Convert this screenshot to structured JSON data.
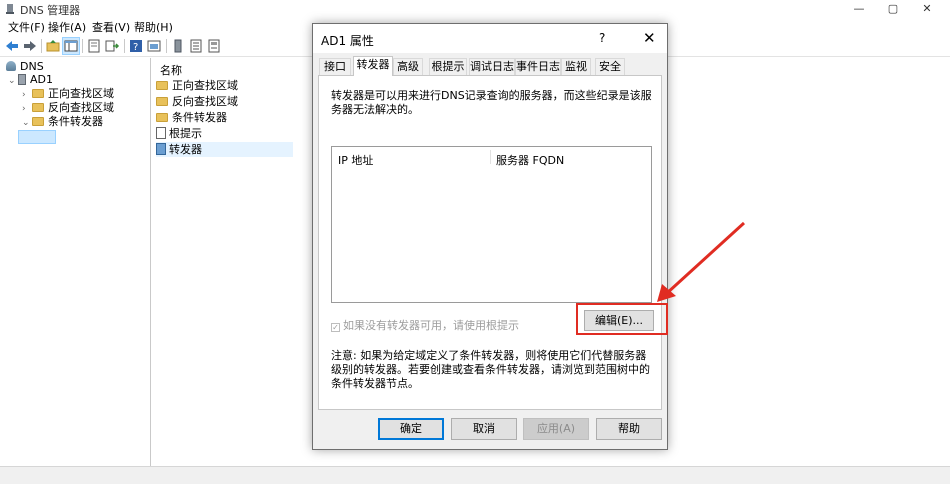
{
  "window": {
    "title": "DNS 管理器",
    "controls": {
      "minimize": "—",
      "maximize": "▢",
      "close": "✕"
    }
  },
  "menu": {
    "file": "文件(F)",
    "action": "操作(A)",
    "view": "查看(V)",
    "help": "帮助(H)"
  },
  "tree": {
    "root": "DNS",
    "server": "AD1",
    "children": [
      "正向查找区域",
      "反向查找区域",
      "条件转发器"
    ]
  },
  "list": {
    "column_name": "名称",
    "rows": [
      "正向查找区域",
      "反向查找区域",
      "条件转发器",
      "根提示",
      "转发器"
    ]
  },
  "dialog": {
    "title": "AD1 属性",
    "help_glyph": "?",
    "close_glyph": "✕",
    "tabs": [
      "接口",
      "转发器",
      "高级",
      "根提示",
      "调试日志",
      "事件日志",
      "监视",
      "安全"
    ],
    "active_tab": "转发器",
    "description": "转发器是可以用来进行DNS记录查询的服务器，而这些纪录是该服务器无法解决的。",
    "columns": {
      "ip": "IP 地址",
      "fqdn": "服务器 FQDN"
    },
    "use_root_hints_label": "如果没有转发器可用，请使用根提示",
    "edit_button": "编辑(E)...",
    "note": "注意: 如果为给定域定义了条件转发器，则将使用它们代替服务器级别的转发器。若要创建或查看条件转发器，请浏览到范围树中的条件转发器节点。",
    "buttons": {
      "ok": "确定",
      "cancel": "取消",
      "apply": "应用(A)",
      "help": "帮助"
    }
  },
  "colors": {
    "annotation_red": "#e02c22",
    "selection_blue": "#cce8ff",
    "default_button_border": "#0078d7"
  }
}
